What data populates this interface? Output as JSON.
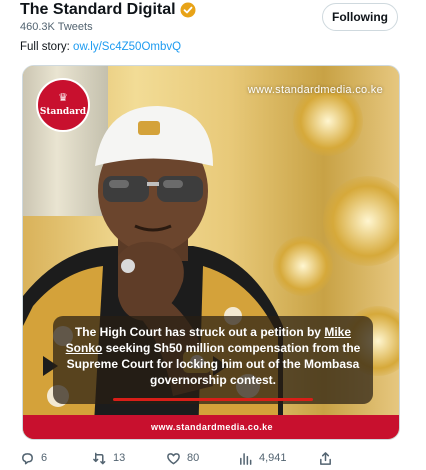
{
  "account": {
    "name": "The Standard Digital",
    "tweet_count": "460.3K Tweets",
    "follow_label": "Following",
    "verified_icon": "verified-badge-icon",
    "verified_color": "#e8a317"
  },
  "tweet": {
    "prefix": "Full story:",
    "link": "ow.ly/Sc4Z50OmbvQ"
  },
  "media": {
    "logo_text": "Standard",
    "watermark": "www.standardmedia.co.ke",
    "caption_part1": "The High Court has struck out a petition by ",
    "caption_name": "Mike Sonko",
    "caption_part2": " seeking Sh50 million compensation from the Supreme Court for locking him out of the Mombasa governorship contest.",
    "footer": "www.standardmedia.co.ke",
    "brand_color": "#c8102e"
  },
  "actions": {
    "replies": "6",
    "retweets": "13",
    "likes": "80",
    "views": "4,941"
  }
}
